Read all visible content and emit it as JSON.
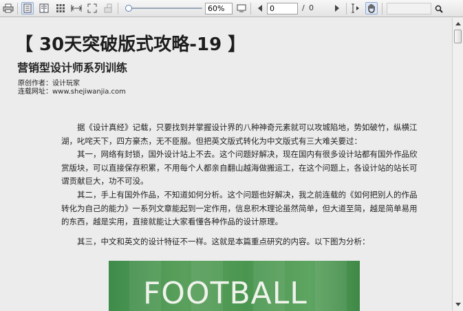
{
  "toolbar": {
    "zoom_value": "60%",
    "page_input": "0",
    "page_separator": "/",
    "page_total": "0",
    "search_value": ""
  },
  "icons": {
    "print": "print-icon",
    "single_page": "single-page-icon",
    "two_page": "two-page-icon",
    "thumbnails": "thumbnails-icon",
    "fit_width": "fit-width-icon",
    "fit_page": "fit-page-icon",
    "fullscreen": "fullscreen-icon",
    "prev": "prev-page-icon",
    "next": "next-page-icon",
    "text_select": "text-select-icon",
    "hand": "hand-tool-icon",
    "search": "search-icon"
  },
  "zoom_slider": {
    "level_fraction": 0.0
  },
  "document": {
    "title": "【 30天突破版式攻略-19 】",
    "subtitle": "营销型设计师系列训练",
    "author": "原创作者：设计玩家",
    "website": "连载网址：www.shejiwanjia.com",
    "paragraphs": [
      "据《设计真经》记载，只要找到并掌握设计界的八种神奇元素就可以攻城陷地，势如破竹，纵横江湖，叱咤天下，四方豪杰，无不臣服。但把英文版式转化为中文版式有三大难关要过：",
      "其一，网络有封锁，国外设计站上不去。这个问题好解决，现在国内有很多设计站都有国外作品欣赏版块，可以直接保存积累，不用每个人都亲自翻山越海做搬运工，在这个问题上，各设计站的站长可谓贡献巨大，功不可没。",
      "其二，手上有国外作品，不知道如何分析。这个问题也好解决，我之前连载的《如何把别人的作品转化为自己的能力》一系列文章能起到一定作用，信息积木理论虽然简单，但大道至简，越是简单易用的东西，越是实用，直接就能让大家看懂各种作品的设计原理。",
      "其三，中文和英文的设计特征不一样。这就是本篇重点研究的内容。以下图为分析："
    ],
    "image_text": "FOOTBALL"
  },
  "colors": {
    "toolbar_bg": "#e9e9e9",
    "doc_bg": "#ececec",
    "active_tool": "#dfe8f6",
    "photo_green": "#4a9650"
  }
}
